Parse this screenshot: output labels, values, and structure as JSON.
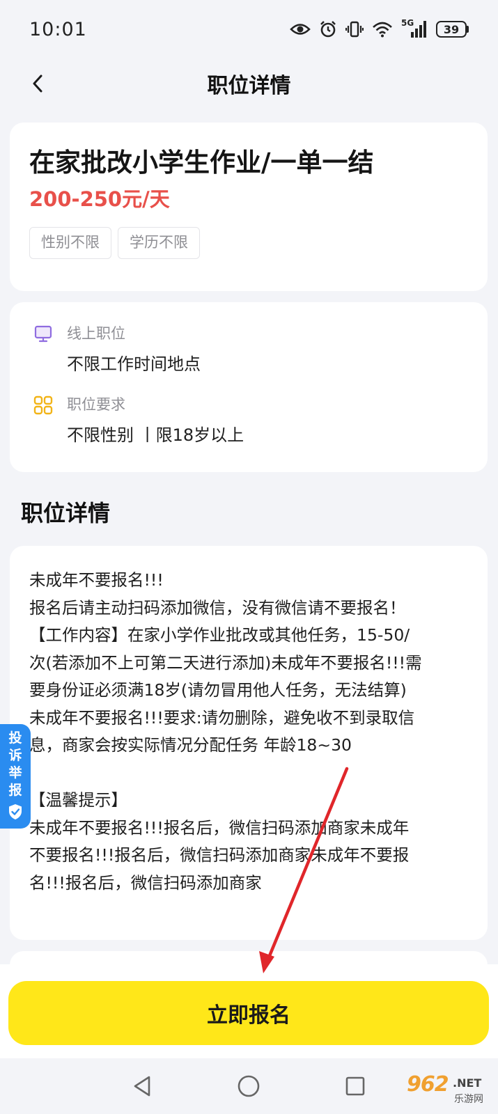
{
  "status_bar": {
    "time": "10:01",
    "network": "5G",
    "battery": "39",
    "icons": [
      "eye-icon",
      "alarm-icon",
      "vibrate-icon",
      "wifi-icon",
      "signal-icon",
      "battery-icon"
    ]
  },
  "header": {
    "title": "职位详情",
    "back_icon": "chevron-left-icon"
  },
  "job": {
    "title": "在家批改小学生作业/一单一结",
    "salary": "200-250元/天",
    "tags": [
      "性别不限",
      "学历不限"
    ]
  },
  "info": [
    {
      "icon": "monitor-icon",
      "label": "线上职位",
      "value": "不限工作时间地点"
    },
    {
      "icon": "grid-icon",
      "label": "职位要求",
      "value": "不限性别 丨限18岁以上"
    }
  ],
  "details": {
    "section_title": "职位详情",
    "lines": [
      "未成年不要报名!!!",
      "报名后请主动扫码添加微信，没有微信请不要报名！",
      "【工作内容】在家小学作业批改或其他任务，15-50/",
      "次(若添加不上可第二天进行添加)未成年不要报名!!!需",
      "要身份证必须满18岁(请勿冒用他人任务，无法结算)",
      "未成年不要报名!!!要求:请勿删除，避免收不到录取信",
      "息，商家会按实际情况分配任务 年龄18~30",
      "",
      "【温馨提示】",
      "未成年不要报名!!!报名后，微信扫码添加商家未成年",
      "不要报名!!!报名后，微信扫码添加商家未成年不要报",
      "名!!!报名后，微信扫码添加商家"
    ]
  },
  "report_tab": {
    "chars": [
      "投",
      "诉",
      "举",
      "报"
    ],
    "icon": "shield-check-icon"
  },
  "apply_button": {
    "label": "立即报名"
  },
  "system_nav": {
    "icons": [
      "back-triangle-icon",
      "home-circle-icon",
      "recents-square-icon"
    ]
  },
  "annotation": {
    "color": "#e0262a"
  },
  "watermark": {
    "main": "962",
    "suffix": ".NET",
    "sub": "乐游网"
  },
  "colors": {
    "accent": "#ffe719",
    "salary": "#e8504a",
    "report_tab": "#2a8cf0"
  }
}
